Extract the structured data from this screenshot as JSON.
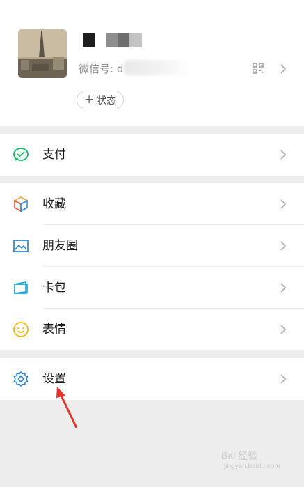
{
  "profile": {
    "wechat_id_label": "微信号: d",
    "status_button": {
      "plus": "+",
      "label": "状态"
    },
    "qr_icon": "qr-code-icon",
    "arrow_icon": "chevron-right-icon"
  },
  "menu": {
    "pay": {
      "label": "支付",
      "icon": "pay-icon",
      "color": "#07c160"
    },
    "favorites": {
      "label": "收藏",
      "icon": "favorites-cube-icon"
    },
    "moments": {
      "label": "朋友圈",
      "icon": "moments-picture-icon",
      "color": "#2782d7"
    },
    "cards": {
      "label": "卡包",
      "icon": "card-wallet-icon",
      "color": "#1fa6d6"
    },
    "stickers": {
      "label": "表情",
      "icon": "sticker-smiley-icon",
      "color": "#f7b500"
    },
    "settings": {
      "label": "设置",
      "icon": "gear-icon",
      "color": "#2782d7"
    }
  },
  "watermark": {
    "main": "Bai 经验",
    "sub": "jingyan.baidu.com"
  },
  "annotation": {
    "color": "#e8332c",
    "icon": "red-pointer-arrow"
  }
}
